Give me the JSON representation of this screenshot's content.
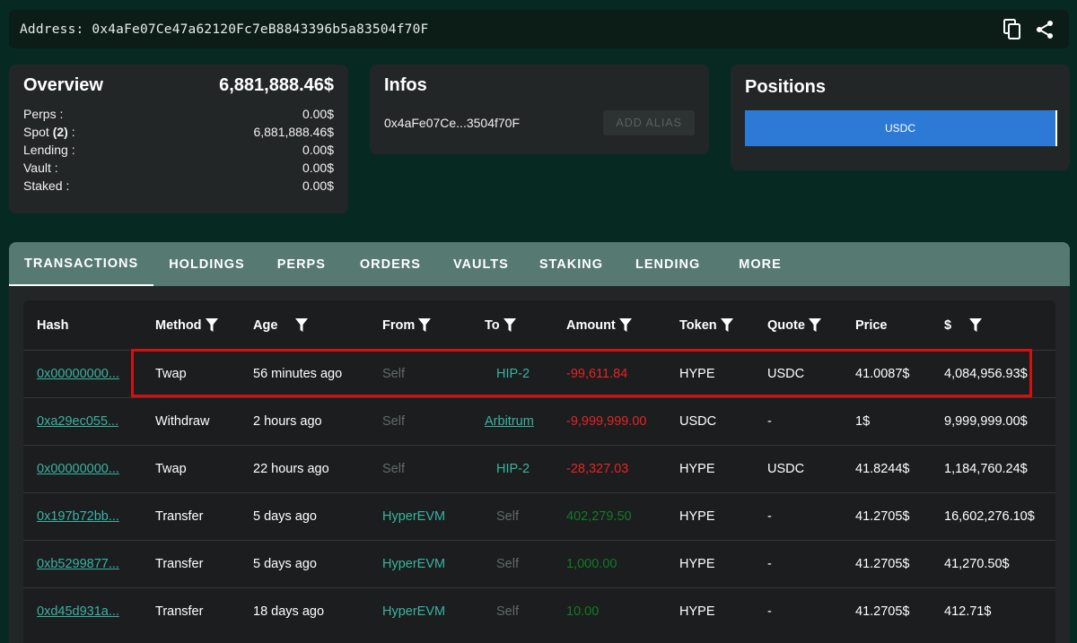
{
  "address_bar": {
    "label": "Address:",
    "address": "0x4aFe07Ce47a62120Fc7eB8843396b5a83504f70F"
  },
  "overview": {
    "title": "Overview",
    "total": "6,881,888.46$",
    "rows": [
      {
        "label": "Perps :",
        "value": "0.00$"
      },
      {
        "label": "Spot (2) :",
        "value": "6,881,888.46$"
      },
      {
        "label": "Lending :",
        "value": "0.00$"
      },
      {
        "label": "Vault :",
        "value": "0.00$"
      },
      {
        "label": "Staked :",
        "value": "0.00$"
      }
    ]
  },
  "infos": {
    "title": "Infos",
    "short_address": "0x4aFe07Ce...3504f70F",
    "add_alias_label": "ADD ALIAS"
  },
  "positions": {
    "title": "Positions",
    "bar_label": "USDC",
    "bar_color": "#2d7ad6"
  },
  "tabs": [
    {
      "label": "TRANSACTIONS",
      "active": true
    },
    {
      "label": "HOLDINGS"
    },
    {
      "label": "PERPS"
    },
    {
      "label": "ORDERS"
    },
    {
      "label": "VAULTS"
    },
    {
      "label": "STAKING"
    },
    {
      "label": "LENDING"
    },
    {
      "label": "MORE"
    }
  ],
  "table": {
    "columns": {
      "hash": "Hash",
      "method": "Method",
      "age": "Age",
      "from": "From",
      "to": "To",
      "amount": "Amount",
      "token": "Token",
      "quote": "Quote",
      "price": "Price",
      "usd": "$"
    },
    "rows": [
      {
        "hash": "0x00000000...",
        "method": "Twap",
        "age": "56 minutes ago",
        "from": "Self",
        "to": "HIP-2",
        "amount": "-99,611.84",
        "token": "HYPE",
        "quote": "USDC",
        "price": "41.0087$",
        "usd": "4,084,956.93$"
      },
      {
        "hash": "0xa29ec055...",
        "method": "Withdraw",
        "age": "2 hours ago",
        "from": "Self",
        "to": "Arbitrum",
        "amount": "-9,999,999.00",
        "token": "USDC",
        "quote": "-",
        "price": "1$",
        "usd": "9,999,999.00$"
      },
      {
        "hash": "0x00000000...",
        "method": "Twap",
        "age": "22 hours ago",
        "from": "Self",
        "to": "HIP-2",
        "amount": "-28,327.03",
        "token": "HYPE",
        "quote": "USDC",
        "price": "41.8244$",
        "usd": "1,184,760.24$"
      },
      {
        "hash": "0x197b72bb...",
        "method": "Transfer",
        "age": "5 days ago",
        "from": "HyperEVM",
        "to": "Self",
        "amount": "402,279.50",
        "token": "HYPE",
        "quote": "-",
        "price": "41.2705$",
        "usd": "16,602,276.10$"
      },
      {
        "hash": "0xb5299877...",
        "method": "Transfer",
        "age": "5 days ago",
        "from": "HyperEVM",
        "to": "Self",
        "amount": "1,000.00",
        "token": "HYPE",
        "quote": "-",
        "price": "41.2705$",
        "usd": "41,270.50$"
      },
      {
        "hash": "0xd45d931a...",
        "method": "Transfer",
        "age": "18 days ago",
        "from": "HyperEVM",
        "to": "Self",
        "amount": "10.00",
        "token": "HYPE",
        "quote": "-",
        "price": "41.2705$",
        "usd": "412.71$"
      }
    ]
  }
}
